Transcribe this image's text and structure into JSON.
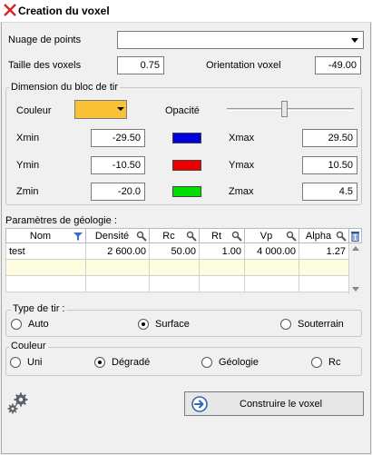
{
  "window": {
    "title": "Creation du voxel"
  },
  "form": {
    "point_cloud_label": "Nuage de points",
    "point_cloud_value": "",
    "voxel_size_label": "Taille des voxels",
    "voxel_size_value": "0.75",
    "orientation_label": "Orientation voxel",
    "orientation_value": "-49.00"
  },
  "block": {
    "group_title": "Dimension du bloc de tir",
    "color_label": "Couleur",
    "color_value": "#f9c236",
    "opacity_label": "Opacité",
    "opacity_level": 0.45,
    "xmin_label": "Xmin",
    "xmin_value": "-29.50",
    "xmax_label": "Xmax",
    "xmax_value": "29.50",
    "ymin_label": "Ymin",
    "ymin_value": "-10.50",
    "ymax_label": "Ymax",
    "ymax_value": "10.50",
    "zmin_label": "Zmin",
    "zmin_value": "-20.0",
    "zmax_label": "Zmax",
    "zmax_value": "4.5",
    "axis_colors": {
      "x": "#0000e0",
      "y": "#ee0000",
      "z": "#00dd00"
    }
  },
  "geology": {
    "label": "Paramètres de géologie :",
    "columns": [
      "Nom",
      "Densité",
      "Rc",
      "Rt",
      "Vp",
      "Alpha"
    ],
    "rows": [
      [
        "test",
        "2 600.00",
        "50.00",
        "1.00",
        "4 000.00",
        "1.27"
      ]
    ]
  },
  "shot_type": {
    "group_title": "Type de tir :",
    "options": [
      "Auto",
      "Surface",
      "Souterrain"
    ],
    "selected": "Surface"
  },
  "color_mode": {
    "group_title": "Couleur",
    "options": [
      "Uni",
      "Dégradé",
      "Géologie",
      "Rc"
    ],
    "selected": "Dégradé"
  },
  "actions": {
    "build_label": "Construire le voxel"
  }
}
